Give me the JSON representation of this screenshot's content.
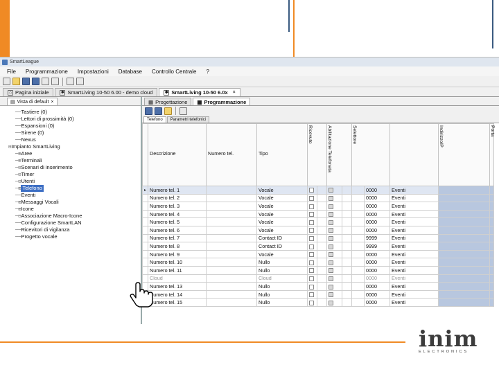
{
  "colors": {
    "accent_orange": "#f08a24",
    "selection_blue": "#3d6fc4",
    "cell_blue": "#b8c7df"
  },
  "brand": {
    "logo": "inim",
    "logo_sub": "ELECTRONICS"
  },
  "window": {
    "title": "SmartLeague"
  },
  "menu": [
    "File",
    "Programmazione",
    "Impostazioni",
    "Database",
    "Controllo Centrale",
    "?"
  ],
  "toolbar_icons": [
    "new-icon",
    "open-folder-icon",
    "save-icon",
    "save-all-icon",
    "print-icon",
    "camera-icon",
    "printer-icon",
    "device-icon"
  ],
  "doc_tabs": [
    {
      "label": "Pagina iniziale"
    },
    {
      "label": "SmartLiving 10-50 6.00 - demo cloud"
    },
    {
      "label": "SmartLiving 10-50 6.0x"
    }
  ],
  "left_panel": {
    "tab_label": "Vista di default"
  },
  "tree": [
    {
      "label": "Tastiere (0)",
      "indent": 1,
      "conn": ""
    },
    {
      "label": "Lettori di prossimità (0)",
      "indent": 1,
      "conn": ""
    },
    {
      "label": "Espansioni (0)",
      "indent": 1,
      "conn": ""
    },
    {
      "label": "Sirene (0)",
      "indent": 1,
      "conn": ""
    },
    {
      "label": "Nexus",
      "indent": 1,
      "conn": ""
    },
    {
      "label": "Impianto SmartLiving",
      "indent": 0,
      "conn": "⊟"
    },
    {
      "label": "Aree",
      "indent": 1,
      "conn": "⊞"
    },
    {
      "label": "Terminali",
      "indent": 1,
      "conn": "⊞"
    },
    {
      "label": "Scenari di inserimento",
      "indent": 1,
      "conn": "⊟"
    },
    {
      "label": "Timer",
      "indent": 1,
      "conn": "⊟"
    },
    {
      "label": "Utenti",
      "indent": 1,
      "conn": "⊟"
    },
    {
      "label": "Telefono",
      "indent": 1,
      "conn": "⊞",
      "selected": true
    },
    {
      "label": "Eventi",
      "indent": 1,
      "conn": ""
    },
    {
      "label": "Messaggi Vocali",
      "indent": 1,
      "conn": "⊞"
    },
    {
      "label": "Icone",
      "indent": 1,
      "conn": "⊞"
    },
    {
      "label": "Associazione Macro-Icone",
      "indent": 1,
      "conn": "⊟"
    },
    {
      "label": "Configurazione SmartLAN",
      "indent": 1,
      "conn": ""
    },
    {
      "label": "Ricevitori di vigilanza",
      "indent": 1,
      "conn": ""
    },
    {
      "label": "Progetto vocale",
      "indent": 1,
      "conn": ""
    }
  ],
  "inner_tabs": [
    "Progettazione",
    "Programmazione"
  ],
  "sub_tabs": [
    "Telefono",
    "Parametri telefonici"
  ],
  "table": {
    "headers": [
      "Descrizione",
      "Numero tel.",
      "Tipo",
      "Ricevuto",
      "Abilitazione Telefonata",
      "Selettore",
      "",
      "IndirizzoIP",
      "",
      "Porta"
    ],
    "rows": [
      [
        "Numero tel. 1",
        "",
        "Vocale",
        "0000",
        "Eventi"
      ],
      [
        "Numero tel. 2",
        "",
        "Vocale",
        "0000",
        "Eventi"
      ],
      [
        "Numero tel. 3",
        "",
        "Vocale",
        "0000",
        "Eventi"
      ],
      [
        "Numero tel. 4",
        "",
        "Vocale",
        "0000",
        "Eventi"
      ],
      [
        "Numero tel. 5",
        "",
        "Vocale",
        "0000",
        "Eventi"
      ],
      [
        "Numero tel. 6",
        "",
        "Vocale",
        "0000",
        "Eventi"
      ],
      [
        "Numero tel. 7",
        "",
        "Contact ID",
        "9999",
        "Eventi"
      ],
      [
        "Numero tel. 8",
        "",
        "Contact ID",
        "9999",
        "Eventi"
      ],
      [
        "Numero tel. 9",
        "",
        "Vocale",
        "0000",
        "Eventi"
      ],
      [
        "Numero tel. 10",
        "",
        "Nullo",
        "0000",
        "Eventi"
      ],
      [
        "Numero tel. 11",
        "",
        "Nullo",
        "0000",
        "Eventi"
      ],
      [
        "Cloud",
        "",
        "Cloud",
        "0000",
        "Eventi"
      ],
      [
        "Numero tel. 13",
        "",
        "Nullo",
        "0000",
        "Eventi"
      ],
      [
        "Numero tel. 14",
        "",
        "Nullo",
        "0000",
        "Eventi"
      ],
      [
        "Numero tel. 15",
        "",
        "Nullo",
        "0000",
        "Eventi"
      ]
    ]
  }
}
